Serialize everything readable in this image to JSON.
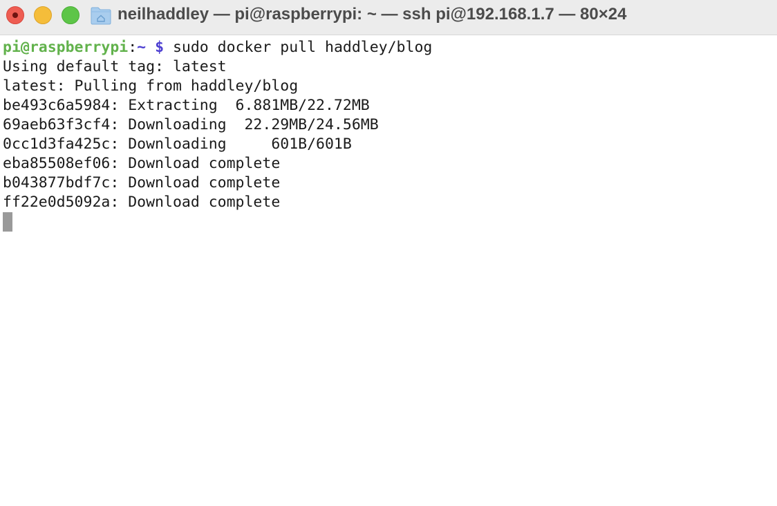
{
  "window": {
    "title": "neilhaddley — pi@raspberrypi: ~ — ssh pi@192.168.1.7 — 80×24"
  },
  "icons": {
    "close": "close-dot-icon",
    "folder": "folder-home-icon"
  },
  "colors": {
    "prompt_user": "#62b24c",
    "prompt_path": "#4d3fd1",
    "titlebar": "#ececec",
    "close": "#ee5d52",
    "minimize": "#f5bd3a",
    "zoom": "#5dc548"
  },
  "terminal": {
    "prompt": {
      "user": "pi@raspberrypi",
      "separator": ":",
      "path": "~",
      "sigil": " $",
      "command": " sudo docker pull haddley/blog"
    },
    "lines": [
      "Using default tag: latest",
      "latest: Pulling from haddley/blog",
      "be493c6a5984: Extracting  6.881MB/22.72MB",
      "69aeb63f3cf4: Downloading  22.29MB/24.56MB",
      "0cc1d3fa425c: Downloading     601B/601B",
      "eba85508ef06: Download complete",
      "b043877bdf7c: Download complete",
      "ff22e0d5092a: Download complete"
    ]
  }
}
